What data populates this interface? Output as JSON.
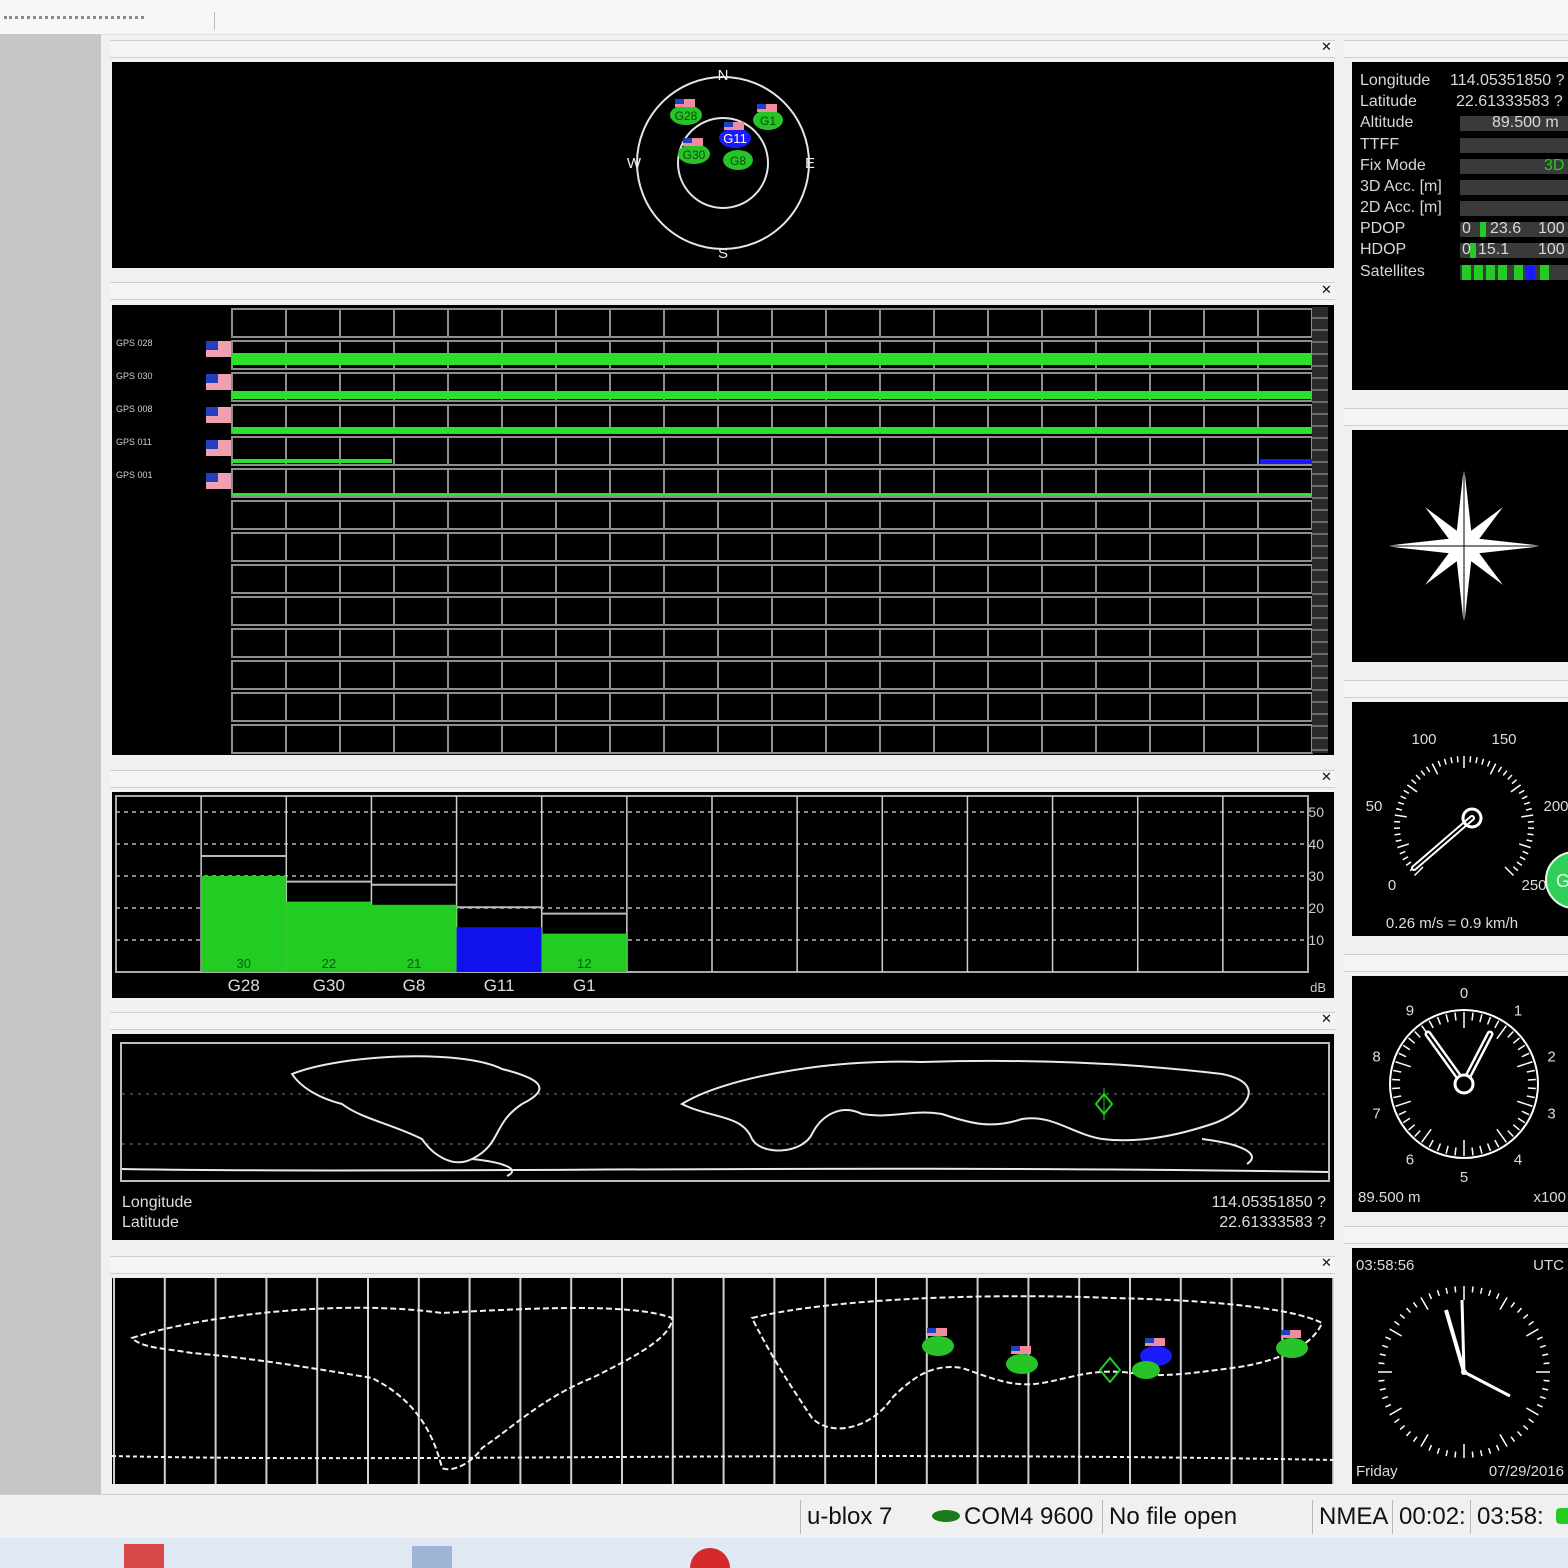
{
  "sky_view": {
    "compass": {
      "n": "N",
      "e": "E",
      "s": "S",
      "w": "W"
    },
    "satellites": [
      {
        "label": "G28",
        "color": "#22cc22"
      },
      {
        "label": "G30",
        "color": "#22cc22"
      },
      {
        "label": "G8",
        "color": "#22cc22"
      },
      {
        "label": "G11",
        "color": "#1a1aff"
      },
      {
        "label": "G1",
        "color": "#22cc22"
      }
    ]
  },
  "deviation_map": {
    "rows": [
      {
        "name": "GPS 028"
      },
      {
        "name": "GPS 030"
      },
      {
        "name": "GPS 008"
      },
      {
        "name": "GPS 011"
      },
      {
        "name": "GPS 001"
      }
    ]
  },
  "chart_data": {
    "type": "bar",
    "categories": [
      "G28",
      "G30",
      "G8",
      "G11",
      "G1"
    ],
    "values": [
      30,
      22,
      21,
      14,
      12
    ],
    "value_labels": [
      "30",
      "22",
      "21",
      "",
      "12"
    ],
    "bar_colors": [
      "#22cc22",
      "#22cc22",
      "#22cc22",
      "#1111ee",
      "#22cc22"
    ],
    "ylim": [
      0,
      55
    ],
    "yticks": [
      "50",
      "40",
      "30",
      "20",
      "10"
    ],
    "unit": "dB",
    "grid": true
  },
  "world_map": {
    "longitude_label": "Longitude",
    "latitude_label": "Latitude",
    "longitude_value": "114.05351850 ?",
    "latitude_value": "22.61333583 ?"
  },
  "navigation": {
    "rows": [
      {
        "label": "Longitude",
        "value": "114.05351850 ?"
      },
      {
        "label": "Latitude",
        "value": "22.61333583 ?"
      },
      {
        "label": "Altitude",
        "value": "89.500 m"
      },
      {
        "label": "TTFF",
        "value": ""
      },
      {
        "label": "Fix Mode",
        "value": "3D"
      },
      {
        "label": "3D Acc. [m]",
        "value": ""
      },
      {
        "label": "2D Acc. [m]",
        "value": ""
      }
    ],
    "pdop": {
      "label": "PDOP",
      "min": "0",
      "value": "23.6",
      "max": "100"
    },
    "hdop": {
      "label": "HDOP",
      "min": "0",
      "value": "15.1",
      "max": "100"
    },
    "satellites_label": "Satellites",
    "satellite_colors": [
      "#22cc22",
      "#22cc22",
      "#22cc22",
      "#1a1aff",
      "#22cc22"
    ]
  },
  "speedometer": {
    "ticks": [
      "0",
      "50",
      "100",
      "150",
      "200",
      "250"
    ],
    "reading": "0.26 m/s = 0.9 km/h",
    "badge": "G"
  },
  "altimeter": {
    "ticks": [
      "0",
      "1",
      "2",
      "3",
      "4",
      "5",
      "6",
      "7",
      "8",
      "9"
    ],
    "reading": "89.500 m",
    "scale": "x100"
  },
  "clock": {
    "time": "03:58:56",
    "zone": "UTC",
    "day": "Friday",
    "date": "07/29/2016"
  },
  "status_bar": {
    "receiver": "u-blox 7",
    "port": "COM4 9600",
    "file": "No file open",
    "protocol": "NMEA",
    "elapsed": "00:02:",
    "utc": "03:58:"
  }
}
